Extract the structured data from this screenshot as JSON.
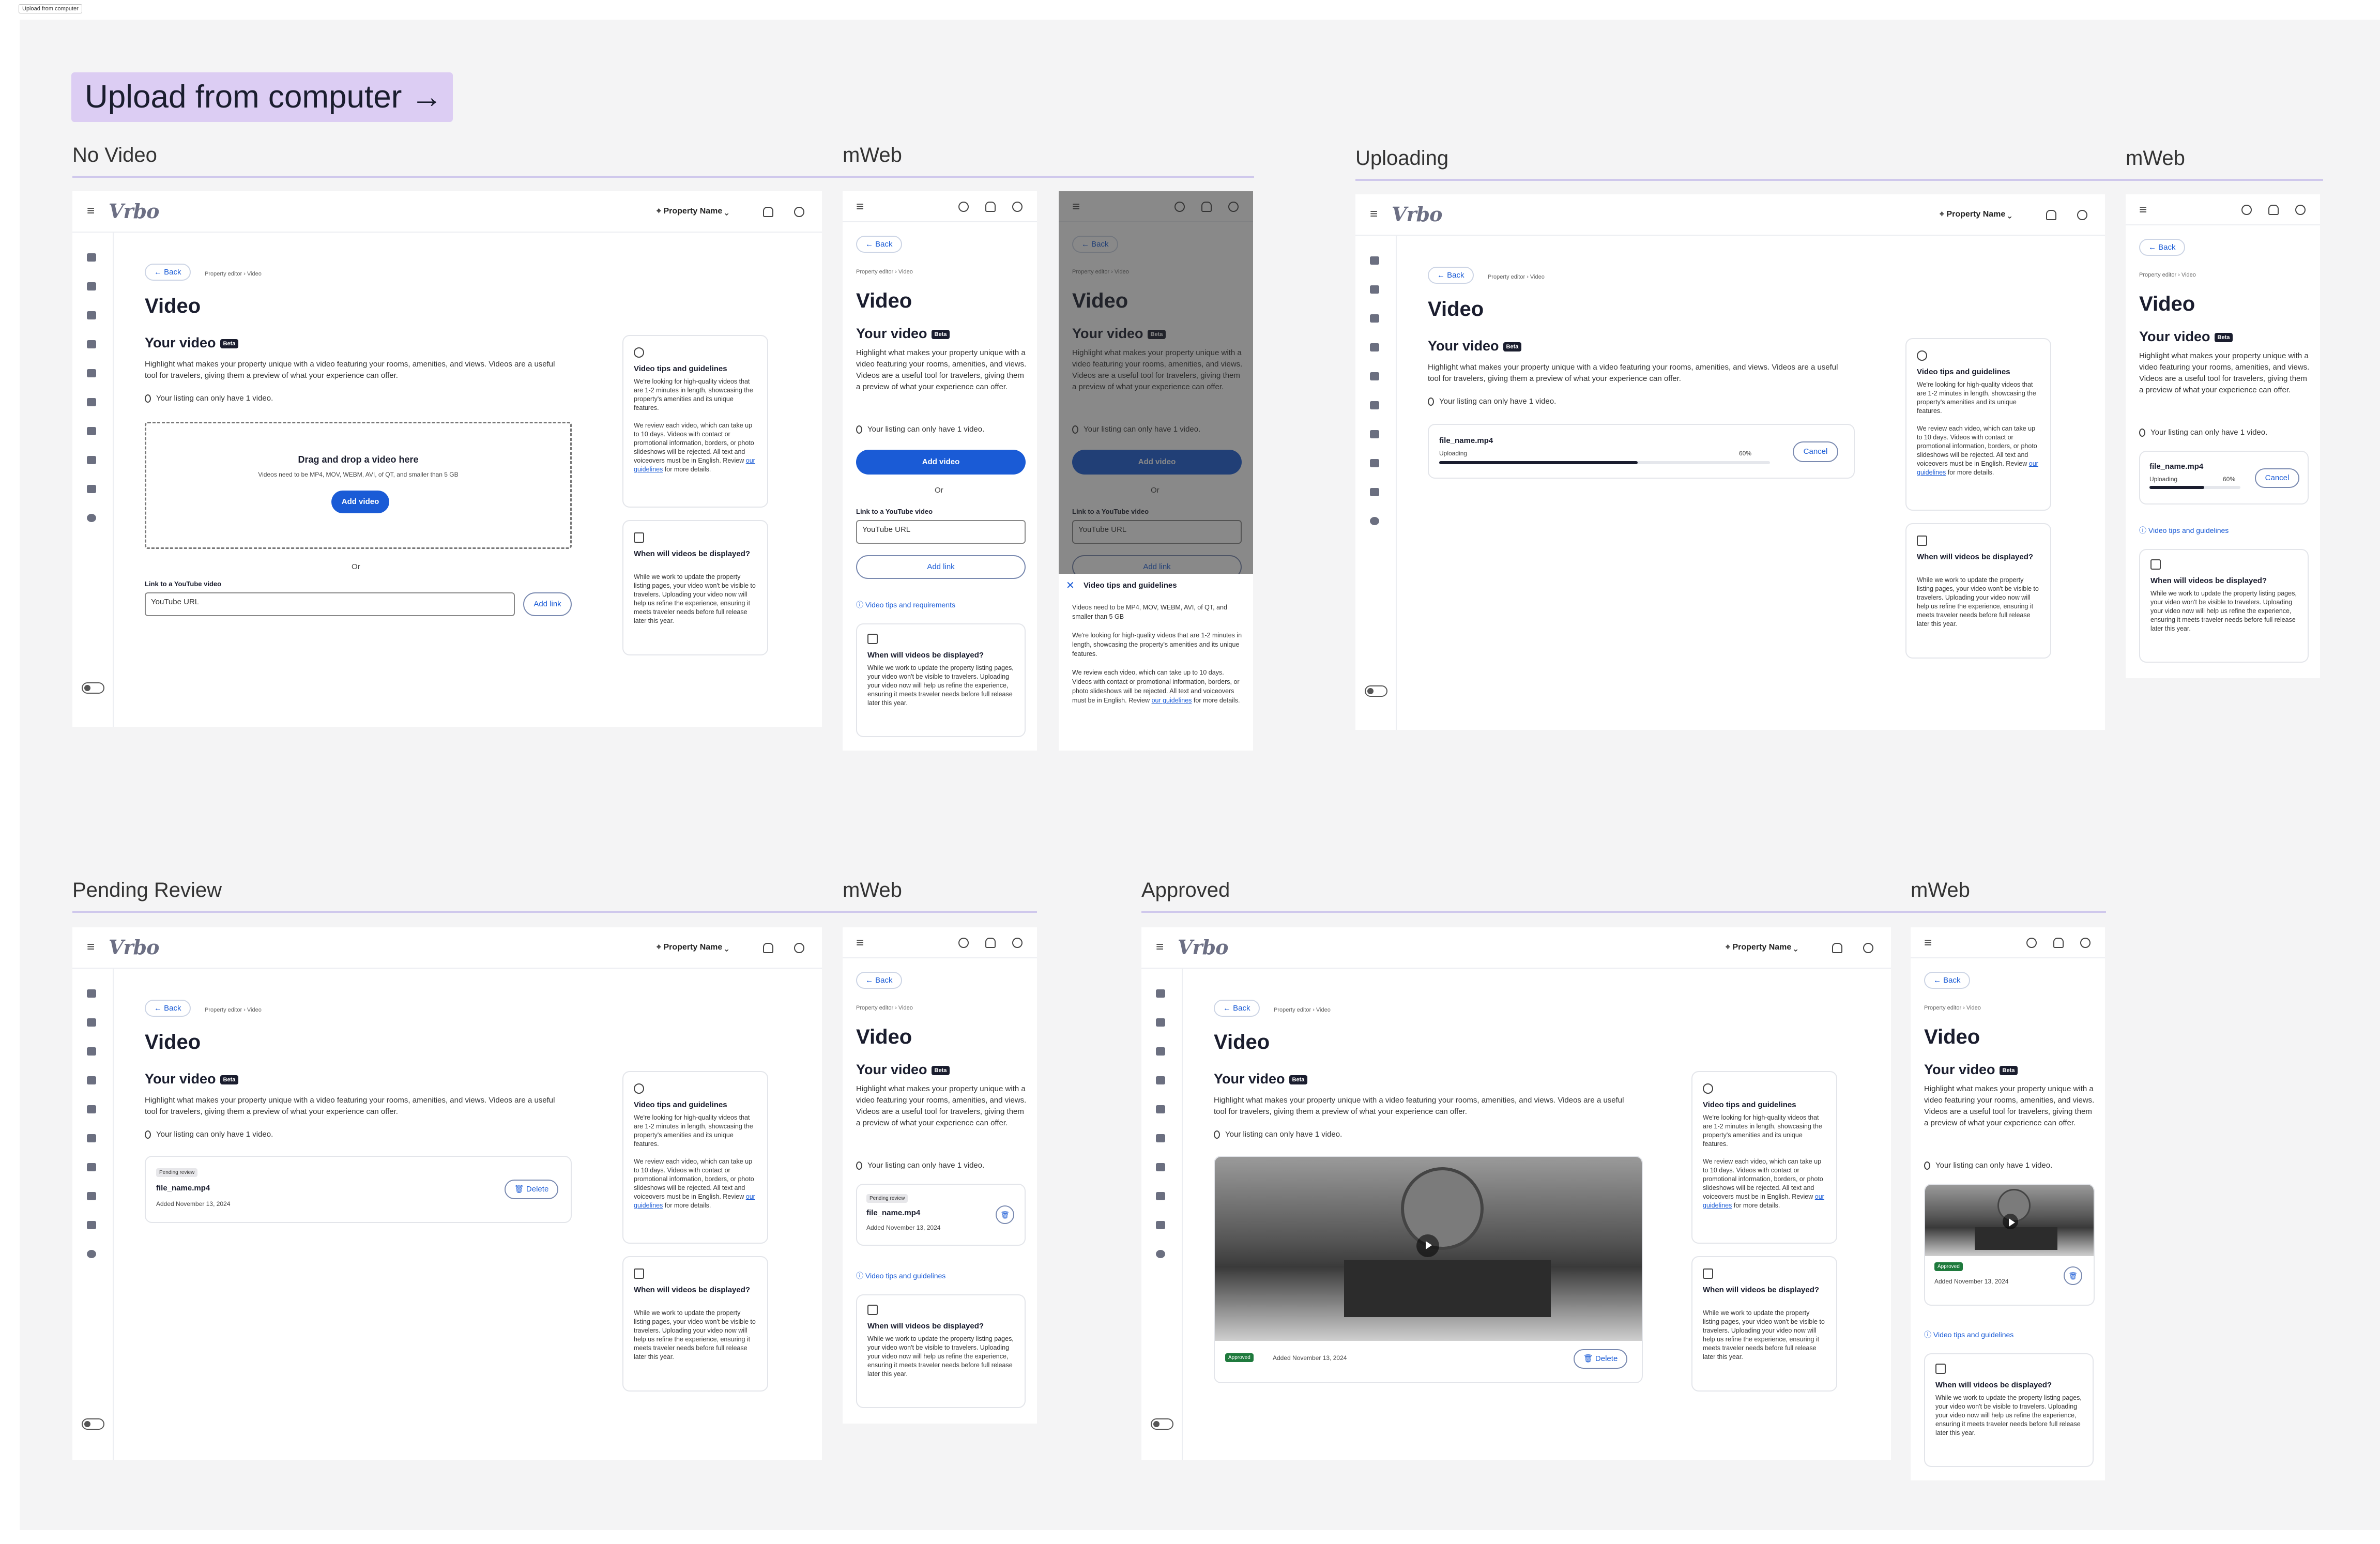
{
  "file_tag": "Upload from computer",
  "heading": "Upload from computer →",
  "sections": {
    "no_video": "No Video",
    "uploading": "Uploading",
    "pending": "Pending Review",
    "approved": "Approved",
    "mweb": "mWeb"
  },
  "nav": {
    "logo": "Vrbo",
    "property_name": "Property Name",
    "menu_icon": "≡"
  },
  "common": {
    "back": "Back",
    "breadcrumb": "Property editor  ›  Video",
    "title": "Video",
    "your_video": "Your video",
    "beta": "Beta",
    "description": "Highlight what makes your property unique with a video featuring your rooms, amenities, and views. Videos are a useful tool for travelers, giving them a preview of what your experience can offer.",
    "limit_note": "Your listing can only have 1 video.",
    "or": "Or",
    "youtube_label": "Link to a YouTube video",
    "youtube_placeholder": "YouTube URL",
    "add_link": "Add link",
    "add_video": "Add video",
    "drag_title": "Drag and drop a video here",
    "drag_sub": "Videos need to be MP4, MOV, WEBM, AVI, of QT, and smaller than 5 GB",
    "file_name": "file_name.mp4",
    "uploading": "Uploading",
    "upload_progress": 0.6,
    "upload_percent": "60%",
    "cancel": "Cancel",
    "delete": "Delete",
    "added": "Added November 13, 2024",
    "pending_badge": "Pending review",
    "approved_badge": "Approved",
    "tips_link": "Video tips and guidelines",
    "tips_link_alt": "Video tips and requirements"
  },
  "tips_card": {
    "title": "Video tips and guidelines",
    "p1": "We're looking for high-quality videos that are 1-2 minutes in length, showcasing the property's amenities and its unique features.",
    "p2": "We review each video, which can take up to 10 days. Videos with contact or promotional information, borders, or photo slideshows will be rejected. All text and voiceovers must be in English. Review",
    "link": "our guidelines",
    "p2_end": "for more details."
  },
  "when_card": {
    "title": "When will videos be displayed?",
    "text": "While we work to update the property listing pages, your video won't be visible to travelers. Uploading your video now will help us refine the experience, ensuring it meets traveler needs before full release later this year."
  },
  "sheet": {
    "title": "Video tips and guidelines",
    "p0": "Videos need to be MP4, MOV, WEBM, AVI, of QT, and smaller than 5 GB",
    "p1": "We're looking for high-quality videos that are 1-2 minutes in length, showcasing the property's amenities and its unique features.",
    "p2": "We review each video, which can take up to 10 days. Videos with contact or promotional information, borders, or photo slideshows will be rejected. All text and voiceovers must be in English. Review",
    "link": "our guidelines",
    "p2_end": "for more details."
  },
  "colors": {
    "accent": "#1a5bd6",
    "pill": "#dccdf3",
    "approved": "#1f7a3d",
    "ink": "#1a1d2e"
  }
}
